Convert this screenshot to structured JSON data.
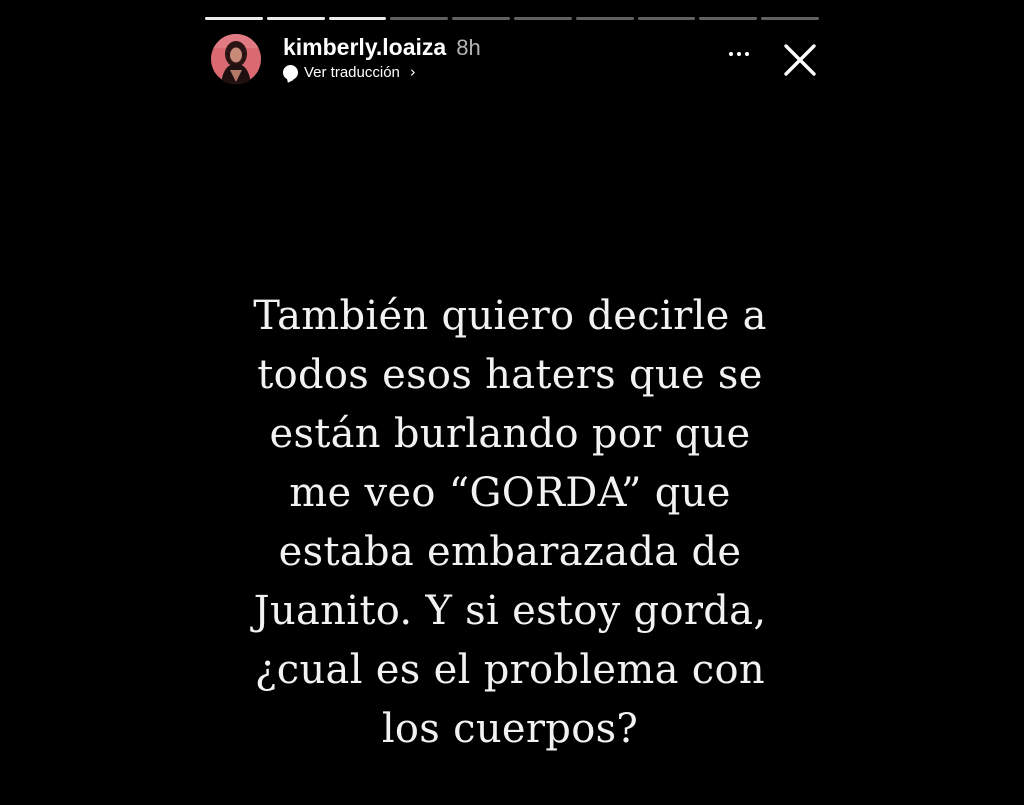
{
  "story": {
    "username": "kimberly.loaiza",
    "time_ago": "8h",
    "translate_label": "Ver traducción",
    "progress": {
      "total_segments": 10,
      "viewed_segments": 3
    },
    "text_lines": [
      "También quiero decirle a",
      "todos esos haters que se",
      "están burlando por que",
      "me veo “GORDA” que",
      "estaba embarazada de",
      "Juanito. Y si estoy gorda,",
      "¿cual es el problema con",
      "los cuerpos?"
    ]
  },
  "icons": {
    "more": "more-horizontal-icon",
    "close": "close-icon",
    "translate": "translate-bubble-icon",
    "chevron": "chevron-right-icon"
  },
  "colors": {
    "background": "#000000",
    "text": "#f2f2f2",
    "avatar_bg": "#d96a72"
  }
}
